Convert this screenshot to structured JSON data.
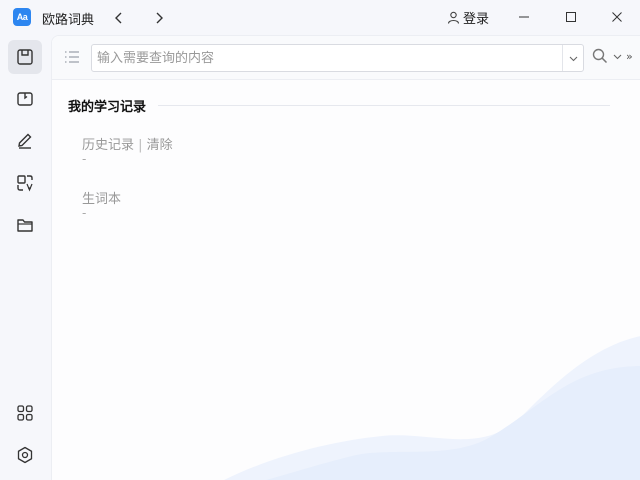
{
  "app": {
    "icon_text": "Aa",
    "title": "欧路词典",
    "login_label": "登录"
  },
  "search": {
    "placeholder": "输入需要查询的内容",
    "value": "",
    "more_label": "»"
  },
  "main": {
    "section_title": "我的学习记录",
    "history": {
      "label": "历史记录",
      "separator": " | ",
      "clear_label": "清除",
      "empty": "-"
    },
    "vocab": {
      "label": "生词本",
      "empty": "-"
    }
  },
  "sidebar": {
    "items": [
      {
        "icon": "dictionary-icon",
        "active": true
      },
      {
        "icon": "book-icon",
        "active": false
      },
      {
        "icon": "pencil-icon",
        "active": false
      },
      {
        "icon": "translate-icon",
        "active": false
      },
      {
        "icon": "folder-icon",
        "active": false
      },
      {
        "icon": "apps-grid-icon",
        "active": false
      },
      {
        "icon": "settings-icon",
        "active": false
      }
    ]
  },
  "colors": {
    "accent": "#2d86f0",
    "background": "#f6f7fb",
    "panel": "#fdfdfe",
    "wave": "#e9f0fd"
  }
}
